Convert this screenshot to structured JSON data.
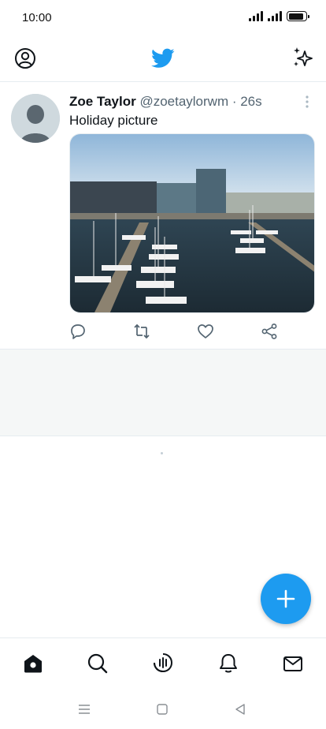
{
  "status_bar": {
    "time": "10:00",
    "battery_level": 0.9
  },
  "header": {
    "profile_icon": "profile-icon",
    "logo_icon": "twitter-bird-icon",
    "sparkle_icon": "sparkle-icon",
    "brand_color": "#1d9bf0"
  },
  "tweet": {
    "author_name": "Zoe Taylor",
    "meta": "@zoetaylorwm · 26s",
    "text": "Holiday picture",
    "media_icon": "harbor-photo",
    "actions": [
      "reply-icon",
      "retweet-icon",
      "like-icon",
      "share-icon"
    ]
  },
  "fab": {
    "icon": "plus-icon",
    "color": "#1d9bf0"
  },
  "bottom_nav": {
    "items": [
      "home-icon",
      "search-icon",
      "spaces-icon",
      "notifications-icon",
      "messages-icon"
    ]
  },
  "system_nav": {
    "items": [
      "menu-icon",
      "home-square-icon",
      "back-icon"
    ]
  }
}
